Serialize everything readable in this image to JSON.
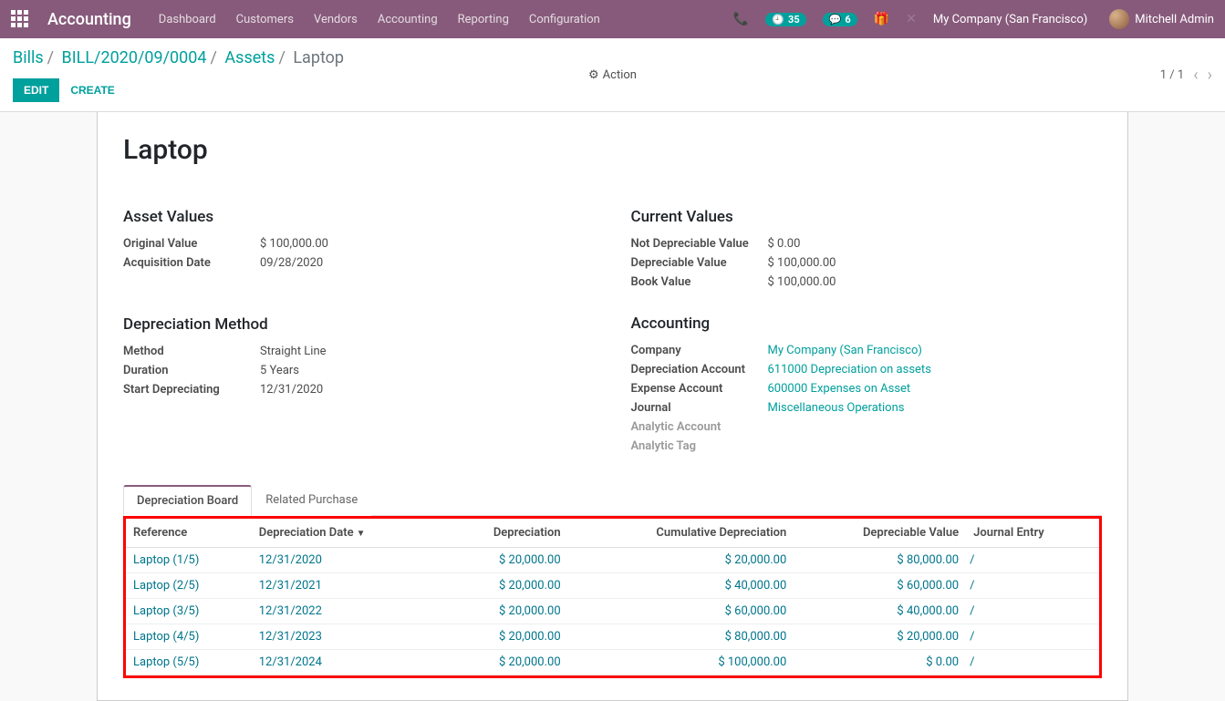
{
  "navbar": {
    "brand": "Accounting",
    "menu": [
      "Dashboard",
      "Customers",
      "Vendors",
      "Accounting",
      "Reporting",
      "Configuration"
    ],
    "badge_activity": "35",
    "badge_discuss": "6",
    "company": "My Company (San Francisco)",
    "user": "Mitchell Admin"
  },
  "breadcrumb": {
    "bills": "Bills",
    "bill_ref": "BILL/2020/09/0004",
    "assets": "Assets",
    "current": "Laptop"
  },
  "toolbar": {
    "edit": "EDIT",
    "create": "CREATE",
    "action": "Action",
    "pager": "1 / 1"
  },
  "record": {
    "title": "Laptop"
  },
  "asset_values": {
    "heading": "Asset Values",
    "original_value_l": "Original Value",
    "original_value": "$ 100,000.00",
    "acquisition_date_l": "Acquisition Date",
    "acquisition_date": "09/28/2020"
  },
  "depreciation_method": {
    "heading": "Depreciation Method",
    "method_l": "Method",
    "method": "Straight Line",
    "duration_l": "Duration",
    "duration": "5 Years",
    "start_l": "Start Depreciating",
    "start": "12/31/2020"
  },
  "current_values": {
    "heading": "Current Values",
    "not_depreciable_l": "Not Depreciable Value",
    "not_depreciable": "$ 0.00",
    "depreciable_l": "Depreciable Value",
    "depreciable": "$ 100,000.00",
    "book_l": "Book Value",
    "book": "$ 100,000.00"
  },
  "accounting": {
    "heading": "Accounting",
    "company_l": "Company",
    "company": "My Company (San Francisco)",
    "dep_acc_l": "Depreciation Account",
    "dep_acc": "611000 Depreciation on assets",
    "exp_acc_l": "Expense Account",
    "exp_acc": "600000 Expenses on Asset",
    "journal_l": "Journal",
    "journal": "Miscellaneous Operations",
    "analytic_acc_l": "Analytic Account",
    "analytic_tag_l": "Analytic Tag"
  },
  "tabs": {
    "board": "Depreciation Board",
    "related": "Related Purchase"
  },
  "table": {
    "headers": {
      "ref": "Reference",
      "date": "Depreciation Date",
      "dep": "Depreciation",
      "cum": "Cumulative Depreciation",
      "val": "Depreciable Value",
      "je": "Journal Entry"
    },
    "rows": [
      {
        "ref": "Laptop (1/5)",
        "date": "12/31/2020",
        "dep": "$ 20,000.00",
        "cum": "$ 20,000.00",
        "val": "$ 80,000.00",
        "je": "/"
      },
      {
        "ref": "Laptop (2/5)",
        "date": "12/31/2021",
        "dep": "$ 20,000.00",
        "cum": "$ 40,000.00",
        "val": "$ 60,000.00",
        "je": "/"
      },
      {
        "ref": "Laptop (3/5)",
        "date": "12/31/2022",
        "dep": "$ 20,000.00",
        "cum": "$ 60,000.00",
        "val": "$ 40,000.00",
        "je": "/"
      },
      {
        "ref": "Laptop (4/5)",
        "date": "12/31/2023",
        "dep": "$ 20,000.00",
        "cum": "$ 80,000.00",
        "val": "$ 20,000.00",
        "je": "/"
      },
      {
        "ref": "Laptop (5/5)",
        "date": "12/31/2024",
        "dep": "$ 20,000.00",
        "cum": "$ 100,000.00",
        "val": "$ 0.00",
        "je": "/"
      }
    ]
  }
}
